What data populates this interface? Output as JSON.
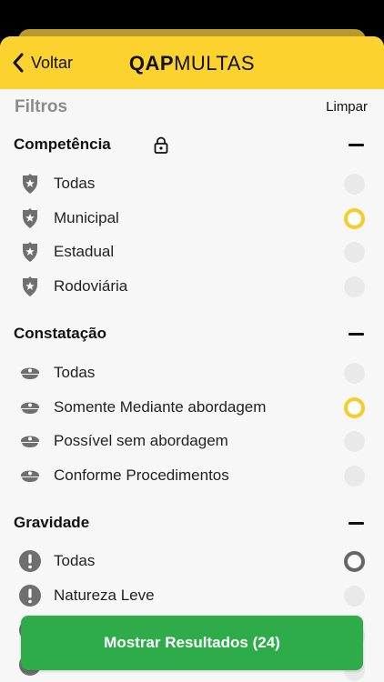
{
  "header": {
    "back_label": "Voltar",
    "logo_bold": "QAP",
    "logo_light": "MULTAS"
  },
  "filters": {
    "title": "Filtros",
    "clear_label": "Limpar"
  },
  "sections": {
    "competencia": {
      "title": "Competência",
      "items": [
        {
          "label": "Todas",
          "selected": false
        },
        {
          "label": "Municipal",
          "selected": true
        },
        {
          "label": "Estadual",
          "selected": false
        },
        {
          "label": "Rodoviária",
          "selected": false
        }
      ]
    },
    "constatacao": {
      "title": "Constatação",
      "items": [
        {
          "label": "Todas",
          "selected": false
        },
        {
          "label": "Somente Mediante abordagem",
          "selected": true
        },
        {
          "label": "Possível sem abordagem",
          "selected": false
        },
        {
          "label": "Conforme Procedimentos",
          "selected": false
        }
      ]
    },
    "gravidade": {
      "title": "Gravidade",
      "items": [
        {
          "label": "Todas",
          "selected": true
        },
        {
          "label": "Natureza Leve",
          "selected": false
        }
      ]
    }
  },
  "cta": {
    "label": "Mostrar Resultados (24)"
  },
  "colors": {
    "brand_yellow": "#fbd22e",
    "cta_green": "#2eac4a",
    "radio_yellow": "#f6cd2b",
    "radio_gray": "#666666"
  }
}
